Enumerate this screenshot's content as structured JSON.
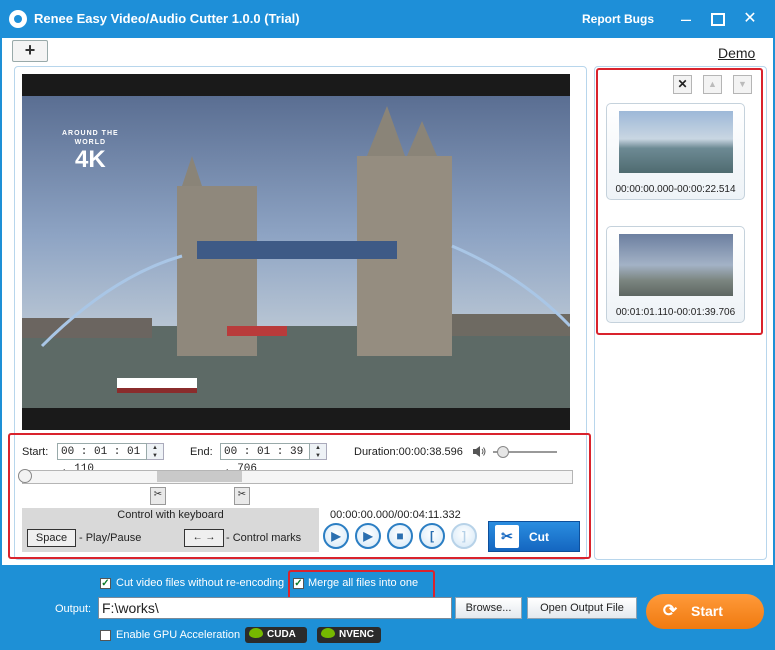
{
  "app": {
    "title": "Renee Easy Video/Audio Cutter 1.0.0 (Trial)",
    "report_bugs": "Report Bugs"
  },
  "toolbar": {
    "add_label": "+",
    "demo_label": "Demo"
  },
  "video": {
    "watermark_top": "AROUND THE",
    "watermark_mid": "WORLD",
    "watermark_big": "4K"
  },
  "controls": {
    "start_label": "Start:",
    "start_value": "00 : 01 : 01 . 110",
    "end_label": "End:",
    "end_value": "00 : 01 : 39 . 706",
    "duration_text": "Duration:00:00:38.596",
    "keyboard_title": "Control with keyboard",
    "space_key": "Space",
    "space_desc": "- Play/Pause",
    "arrow_keys": "← →",
    "arrow_desc": "- Control marks",
    "timecode": "00:00:00.000/00:04:11.332",
    "cut_label": "Cut"
  },
  "clips": [
    {
      "time": "00:00:00.000-00:00:22.514"
    },
    {
      "time": "00:01:01.110-00:01:39.706"
    }
  ],
  "bottom": {
    "cut_without_reencoding": "Cut video files without re-encoding",
    "merge_all": "Merge all files into one",
    "output_label": "Output:",
    "output_value": "F:\\works\\",
    "browse_label": "Browse...",
    "open_output_label": "Open Output File",
    "start_label": "Start",
    "gpu_label": "Enable GPU Acceleration",
    "cuda_label": "CUDA",
    "nvenc_label": "NVENC"
  },
  "colors": {
    "titlebar": "#1e8fd8",
    "highlight": "#d9232d",
    "start_button": "#f58a20",
    "cut_button": "#1c7ad4"
  }
}
